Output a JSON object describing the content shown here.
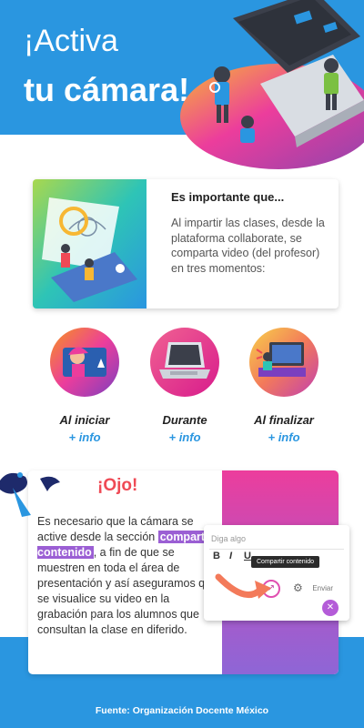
{
  "header": {
    "title_line1": "¡Activa",
    "title_line2": "tu cámara!"
  },
  "intro": {
    "heading": "Es importante que...",
    "text": "Al impartir las clases, desde la plataforma collaborate, se comparta video (del profesor) en tres momentos:"
  },
  "moments": [
    {
      "label": "Al iniciar",
      "info": "+ info"
    },
    {
      "label": "Durante",
      "info": "+ info"
    },
    {
      "label": "Al finalizar",
      "info": "+ info"
    }
  ],
  "ojo": {
    "title": "¡Ojo!",
    "text_before": "Es necesario que la cámara se active desde la sección",
    "highlight": "compartir contenido",
    "text_after": ", a fin de que se muestren en toda el área de presentación y así aseguramos que se visualice su video en la grabación para los alumnos que consultan la clase en diferido."
  },
  "editor": {
    "placeholder": "Diga algo",
    "bold": "B",
    "italic": "I",
    "underline": "U",
    "tooltip": "Compartir contenido",
    "send": "Enviar"
  },
  "footer": {
    "text": "Fuente:  Organización Docente México"
  },
  "colors": {
    "primary_blue": "#2a96e0",
    "accent_pink": "#ec3d9c",
    "accent_purple": "#9b5fd4",
    "ojo_red": "#ef4a55"
  }
}
